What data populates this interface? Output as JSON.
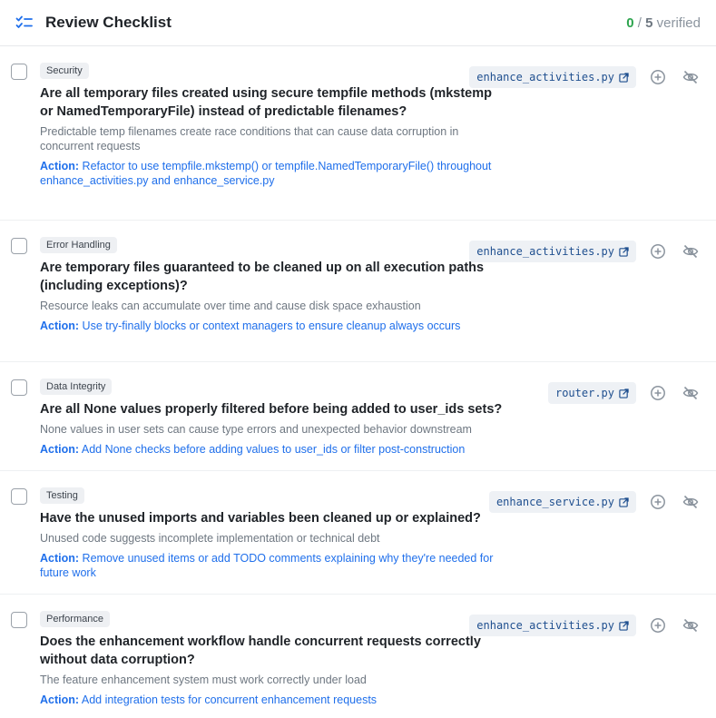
{
  "header": {
    "icon": "checklist-icon",
    "title": "Review Checklist",
    "verified_count": "0",
    "separator": "/",
    "total_count": "5",
    "verified_label": "verified"
  },
  "items": [
    {
      "tag": "Security",
      "question": "Are all temporary files created using secure tempfile methods (mkstemp or NamedTemporaryFile) instead of predictable filenames?",
      "description": "Predictable temp filenames create race conditions that can cause data corruption in concurrent requests",
      "action_label": "Action:",
      "action_text": "Refactor to use tempfile.mkstemp() or tempfile.NamedTemporaryFile() throughout enhance_activities.py and enhance_service.py",
      "file": "enhance_activities.py"
    },
    {
      "tag": "Error Handling",
      "question": "Are temporary files guaranteed to be cleaned up on all execution paths (including exceptions)?",
      "description": "Resource leaks can accumulate over time and cause disk space exhaustion",
      "action_label": "Action:",
      "action_text": "Use try-finally blocks or context managers to ensure cleanup always occurs",
      "file": "enhance_activities.py"
    },
    {
      "tag": "Data Integrity",
      "question": "Are all None values properly filtered before being added to user_ids sets?",
      "description": "None values in user sets can cause type errors and unexpected behavior downstream",
      "action_label": "Action:",
      "action_text": "Add None checks before adding values to user_ids or filter post-construction",
      "file": "router.py"
    },
    {
      "tag": "Testing",
      "question": "Have the unused imports and variables been cleaned up or explained?",
      "description": "Unused code suggests incomplete implementation or technical debt",
      "action_label": "Action:",
      "action_text": "Remove unused items or add TODO comments explaining why they're needed for future work",
      "file": "enhance_service.py"
    },
    {
      "tag": "Performance",
      "question": "Does the enhancement workflow handle concurrent requests correctly without data corruption?",
      "description": "The feature enhancement system must work correctly under load",
      "action_label": "Action:",
      "action_text": "Add integration tests for concurrent enhancement requests",
      "file": "enhance_activities.py"
    }
  ]
}
